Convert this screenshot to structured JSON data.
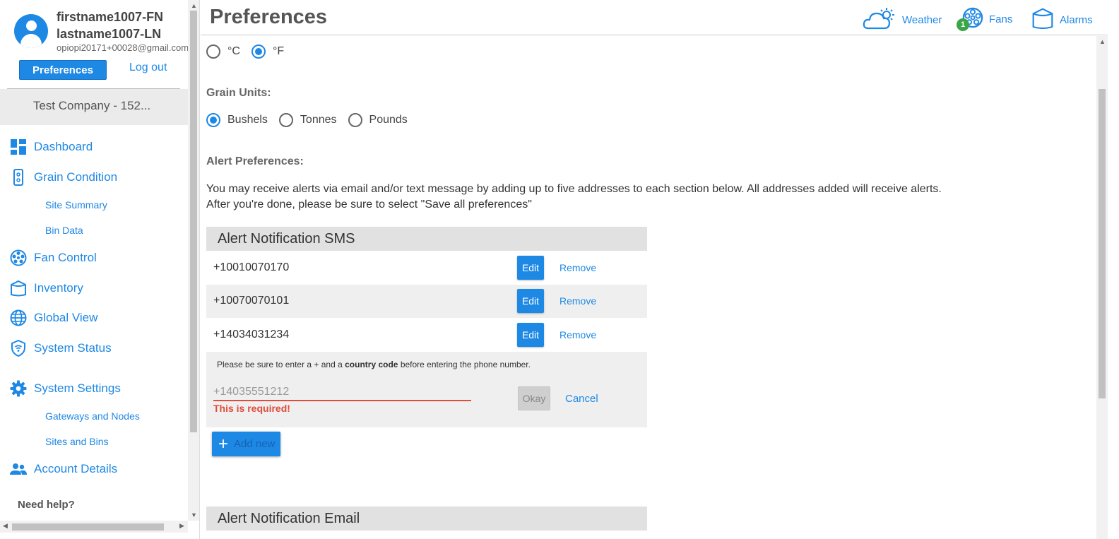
{
  "user": {
    "first_name": "firstname1007-FN",
    "last_name": "lastname1007-LN",
    "email": "opiopi20171+00028@gmail.com",
    "preferences_label": "Preferences",
    "logout_label": "Log out",
    "company": "Test Company - 152..."
  },
  "nav": {
    "dashboard": "Dashboard",
    "grain_condition": "Grain Condition",
    "site_summary": "Site Summary",
    "bin_data": "Bin Data",
    "fan_control": "Fan Control",
    "inventory": "Inventory",
    "global_view": "Global View",
    "system_status": "System Status",
    "system_settings": "System Settings",
    "gateways_nodes": "Gateways and Nodes",
    "sites_bins": "Sites and Bins",
    "account_details": "Account Details",
    "need_help": "Need help?"
  },
  "header": {
    "title": "Preferences",
    "weather": "Weather",
    "fans": "Fans",
    "fans_badge": "1",
    "alarms": "Alarms"
  },
  "temperature": {
    "celsius": "°C",
    "fahrenheit": "°F",
    "selected": "°F"
  },
  "grain_units": {
    "label": "Grain Units:",
    "options": [
      "Bushels",
      "Tonnes",
      "Pounds"
    ],
    "selected": "Bushels"
  },
  "alerts": {
    "label": "Alert Preferences:",
    "intro_line1": "You may receive alerts via email and/or text message by adding up to five addresses to each section below. All addresses added will receive alerts.",
    "intro_line2": "After you're done, please be sure to select \"Save all preferences\""
  },
  "sms": {
    "title": "Alert Notification SMS",
    "numbers": [
      "+10010070170",
      "+10070070101",
      "+14034031234"
    ],
    "edit_label": "Edit",
    "remove_label": "Remove",
    "note_prefix": "Please be sure to enter a + and a ",
    "note_bold": "country code",
    "note_suffix": " before entering the phone number.",
    "input_placeholder": "+14035551212",
    "error": "This is required!",
    "okay_label": "Okay",
    "cancel_label": "Cancel",
    "add_label": "Add new"
  },
  "email": {
    "title": "Alert Notification Email"
  },
  "colors": {
    "accent": "#1e88e5",
    "error": "#e04b3a",
    "badge": "#3aa645"
  }
}
